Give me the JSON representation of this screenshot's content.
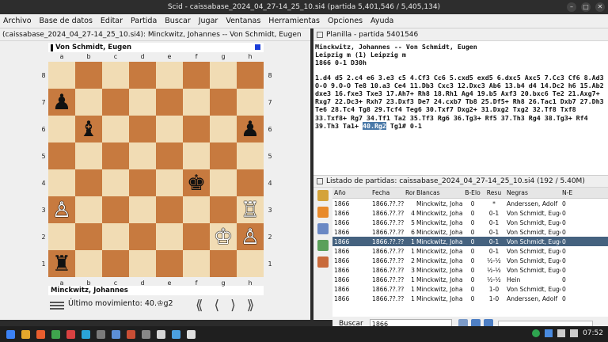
{
  "window": {
    "title": "Scid - caissabase_2024_04_27-14_25_10.si4 (partida 5,401,546 / 5,405,134)"
  },
  "menu": [
    "Archivo",
    "Base de datos",
    "Editar",
    "Partida",
    "Buscar",
    "Jugar",
    "Ventanas",
    "Herramientas",
    "Opciones",
    "Ayuda"
  ],
  "board_pane": {
    "title": "(caissabase_2024_04_27-14_25_10.si4): Minckwitz, Johannes -- Von Schmidt, Eugen",
    "top_player": "Von Schmidt, Eugen",
    "bottom_player": "Minckwitz, Johannes",
    "last_move_label": "Último movimiento: 40.♔g2",
    "files": [
      "a",
      "b",
      "c",
      "d",
      "e",
      "f",
      "g",
      "h"
    ],
    "ranks": [
      "8",
      "7",
      "6",
      "5",
      "4",
      "3",
      "2",
      "1"
    ],
    "position": [
      [
        "",
        "",
        "",
        "",
        "",
        "",
        "",
        ""
      ],
      [
        "bp",
        "",
        "",
        "",
        "",
        "",
        "",
        ""
      ],
      [
        "",
        "bb",
        "",
        "",
        "",
        "",
        "",
        "bp"
      ],
      [
        "",
        "",
        "",
        "",
        "",
        "",
        "",
        ""
      ],
      [
        "",
        "",
        "",
        "",
        "",
        "bk",
        "",
        ""
      ],
      [
        "wp",
        "",
        "",
        "",
        "",
        "",
        "",
        "wr"
      ],
      [
        "",
        "",
        "",
        "",
        "",
        "",
        "wk",
        "wp"
      ],
      [
        "br",
        "",
        "",
        "",
        "",
        "",
        "",
        ""
      ]
    ],
    "pieces": {
      "bp": "♟",
      "bb": "♝",
      "bk": "♚",
      "br": "♜",
      "wp": "♙",
      "wr": "♖",
      "wk": "♔"
    },
    "nav": [
      "⟪",
      "⟨",
      "⟩",
      "⟫"
    ]
  },
  "notation_pane": {
    "title": "Planilla - partida 5401546",
    "header1": "Minckwitz, Johannes  --  Von Schmidt, Eugen",
    "header2": "Leipzig m (1)  Leipzig m",
    "header3": "1866  0-1  D30h",
    "moves_before": "1.d4 d5 2.c4 e6 3.e3 c5 4.Cf3 Cc6 5.cxd5 exd5 6.dxc5 Axc5 7.Cc3 Cf6 8.Ad3 O-O 9.O-O Te8 10.a3 Ce4 11.Db3 Cxc3 12.Dxc3 Ab6 13.b4 d4 14.Dc2 h6 15.Ab2 dxe3 16.fxe3 Txe3 17.Ah7+ Rh8 18.Rh1 Ag4 19.b5 Axf3 20.bxc6 Te2 21.Axg7+ Rxg7 22.Dc3+ Rxh7 23.Dxf3 De7 24.cxb7 Tb8 25.Df5+ Rh8 26.Tac1 Dxb7 27.Dh3 Te6 28.Tc4 Tg8 29.Tcf4 Teg6 30.Txf7 Dxg2+ 31.Dxg2 Txg2 32.Tf8 Txf8 33.Txf8+ Rg7 34.Tf1 Ta2 35.Tf3 Rg6 36.Tg3+ Rf5 37.Th3 Rg4 38.Tg3+ Rf4 39.Th3 Ta1+ ",
    "current_move": "40.Rg2",
    "moves_after": " Tg1# 0-1"
  },
  "game_list": {
    "title": "Listado de partidas: caissabase_2024_04_27-14_25_10.si4 (192 / 5.40M)",
    "columns": [
      "Año",
      "Fecha",
      "Ron",
      "Blancas",
      "B-Elo",
      "Resu",
      "Negras",
      "N-E"
    ],
    "rows": [
      [
        "1866",
        "1866.??.??",
        "",
        "Minckwitz, Johann",
        "0",
        "*",
        "Anderssen, Adolf",
        "0"
      ],
      [
        "1866",
        "1866.??.??",
        "4",
        "Minckwitz, Johann",
        "0",
        "0-1",
        "Von Schmidt, Euge",
        "0"
      ],
      [
        "1866",
        "1866.??.??",
        "5",
        "Minckwitz, Johann",
        "0",
        "0-1",
        "Von Schmidt, Euge",
        "0"
      ],
      [
        "1866",
        "1866.??.??",
        "6",
        "Minckwitz, Johann",
        "0",
        "0-1",
        "Von Schmidt, Euge",
        "0"
      ],
      [
        "1866",
        "1866.??.??",
        "1",
        "Minckwitz, Johann",
        "0",
        "0-1",
        "Von Schmidt, Euge",
        "0"
      ],
      [
        "1866",
        "1866.??.??",
        "1",
        "Minckwitz, Johann",
        "0",
        "0-1",
        "Von Schmidt, Euge",
        "0"
      ],
      [
        "1866",
        "1866.??.??",
        "2",
        "Minckwitz, Johann",
        "0",
        "½-½",
        "Von Schmidt, Euge",
        "0"
      ],
      [
        "1866",
        "1866.??.??",
        "3",
        "Minckwitz, Johann",
        "0",
        "½-½",
        "Von Schmidt, Euge",
        "0"
      ],
      [
        "1866",
        "1866.??.??",
        "1",
        "Minckwitz, Johann",
        "0",
        "½-½",
        "Hein",
        "0"
      ],
      [
        "1866",
        "1866.??.??",
        "1",
        "Minckwitz, Johann",
        "0",
        "1-0",
        "Von Schmidt, Euge",
        "0"
      ],
      [
        "1866",
        "1866.??.??",
        "1",
        "Minckwitz, Johann",
        "0",
        "1-0",
        "Anderssen, Adolf",
        "0"
      ]
    ],
    "selected_row": 4,
    "search_label": "Buscar",
    "search_value": "1866"
  },
  "taskbar": {
    "clock": "07:52"
  },
  "colors": {
    "light_square": "#f1dcb4",
    "dark_square": "#c77a3f",
    "selection": "#45627f",
    "highlight": "#4a79a8"
  }
}
